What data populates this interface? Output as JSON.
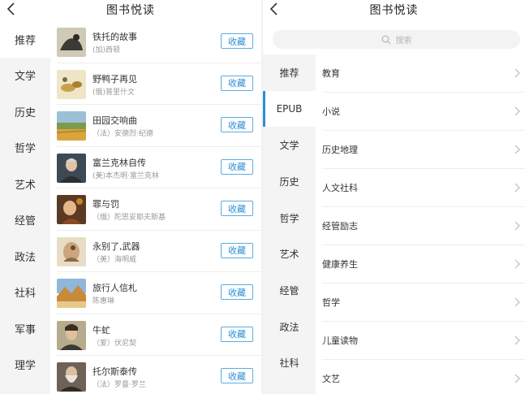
{
  "left": {
    "title": "图书悦读",
    "categories": [
      "推荐",
      "文学",
      "历史",
      "哲学",
      "艺术",
      "经管",
      "政法",
      "社科",
      "军事",
      "理学"
    ],
    "active_category": 0,
    "fav_label": "收藏",
    "books": [
      {
        "title": "铁托的故事",
        "author": "(加)西顿",
        "cover": "cover-tito-icon"
      },
      {
        "title": "野鸭子再见",
        "author": "(俄)普里什文",
        "cover": "cover-duck-icon"
      },
      {
        "title": "田园交响曲",
        "author": "（法）安德烈·纪德",
        "cover": "cover-field-icon"
      },
      {
        "title": "富兰克林自传",
        "author": "(美)本杰明·富兰克林",
        "cover": "cover-franklin-icon"
      },
      {
        "title": "罪与罚",
        "author": "（俄）陀思妥耶夫斯基",
        "cover": "cover-crime-icon"
      },
      {
        "title": "永别了,武器",
        "author": "（美）海明威",
        "cover": "cover-arms-icon"
      },
      {
        "title": "旅行人信札",
        "author": "陈惠琳",
        "cover": "cover-travel-icon"
      },
      {
        "title": "牛虻",
        "author": "（爱）伏尼契",
        "cover": "cover-gadfly-icon"
      },
      {
        "title": "托尔斯泰传",
        "author": "（法）罗曼·罗兰",
        "cover": "cover-tolstoy-icon"
      }
    ]
  },
  "right": {
    "title": "图书悦读",
    "search_placeholder": "搜索",
    "categories": [
      "推荐",
      "EPUB",
      "文学",
      "历史",
      "哲学",
      "艺术",
      "经管",
      "政法",
      "社科"
    ],
    "active_category": 1,
    "subcategories": [
      "教育",
      "小说",
      "历史地理",
      "人文社科",
      "经管励志",
      "健康养生",
      "哲学",
      "儿童读物",
      "文艺"
    ]
  },
  "colors": {
    "accent": "#2d8fd4",
    "sidebar_bg": "#f4f4f4",
    "text": "#333333",
    "muted": "#999999"
  }
}
